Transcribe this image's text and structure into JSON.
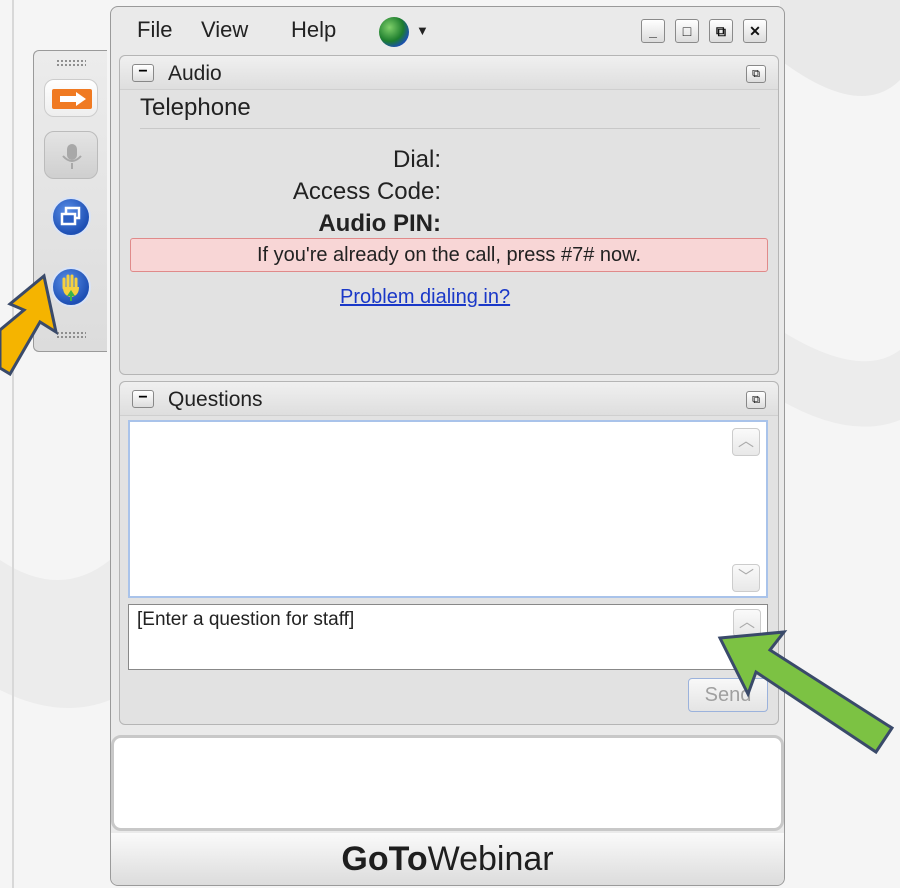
{
  "menu": {
    "items": [
      "File",
      "View",
      "Help"
    ]
  },
  "window_controls": {
    "minimize": "_",
    "maximize": "□",
    "restore": "⧉",
    "close": "✕"
  },
  "audio": {
    "title": "Audio",
    "collapse": "−",
    "popout": "⧉",
    "telephone": "Telephone",
    "dial_label": "Dial:",
    "access_code_label": "Access Code:",
    "audio_pin_label": "Audio PIN:",
    "alert": "If you're already on the call, press #7# now.",
    "problem_link": "Problem dialing in?"
  },
  "questions": {
    "title": "Questions",
    "collapse": "−",
    "popout": "⧉",
    "input_placeholder": "[Enter a question for staff]",
    "send_label": "Send",
    "scroll_up": "︿",
    "scroll_down": "﹀"
  },
  "brand": {
    "go": "GoTo",
    "webinar": "Webinar"
  },
  "icons": {
    "toolbar_grip": "grip-icon",
    "orange_arrow": "arrow-right-icon",
    "microphone": "microphone-icon",
    "window_toggle": "window-restore-icon",
    "raise_hand": "raise-hand-icon",
    "globe": "globe-icon"
  },
  "colors": {
    "accent_orange": "#f07a22",
    "alert_bg": "#f8d6d6",
    "link": "#1a38c8",
    "callout_yellow": "#f5b400",
    "callout_green": "#7cc243"
  }
}
